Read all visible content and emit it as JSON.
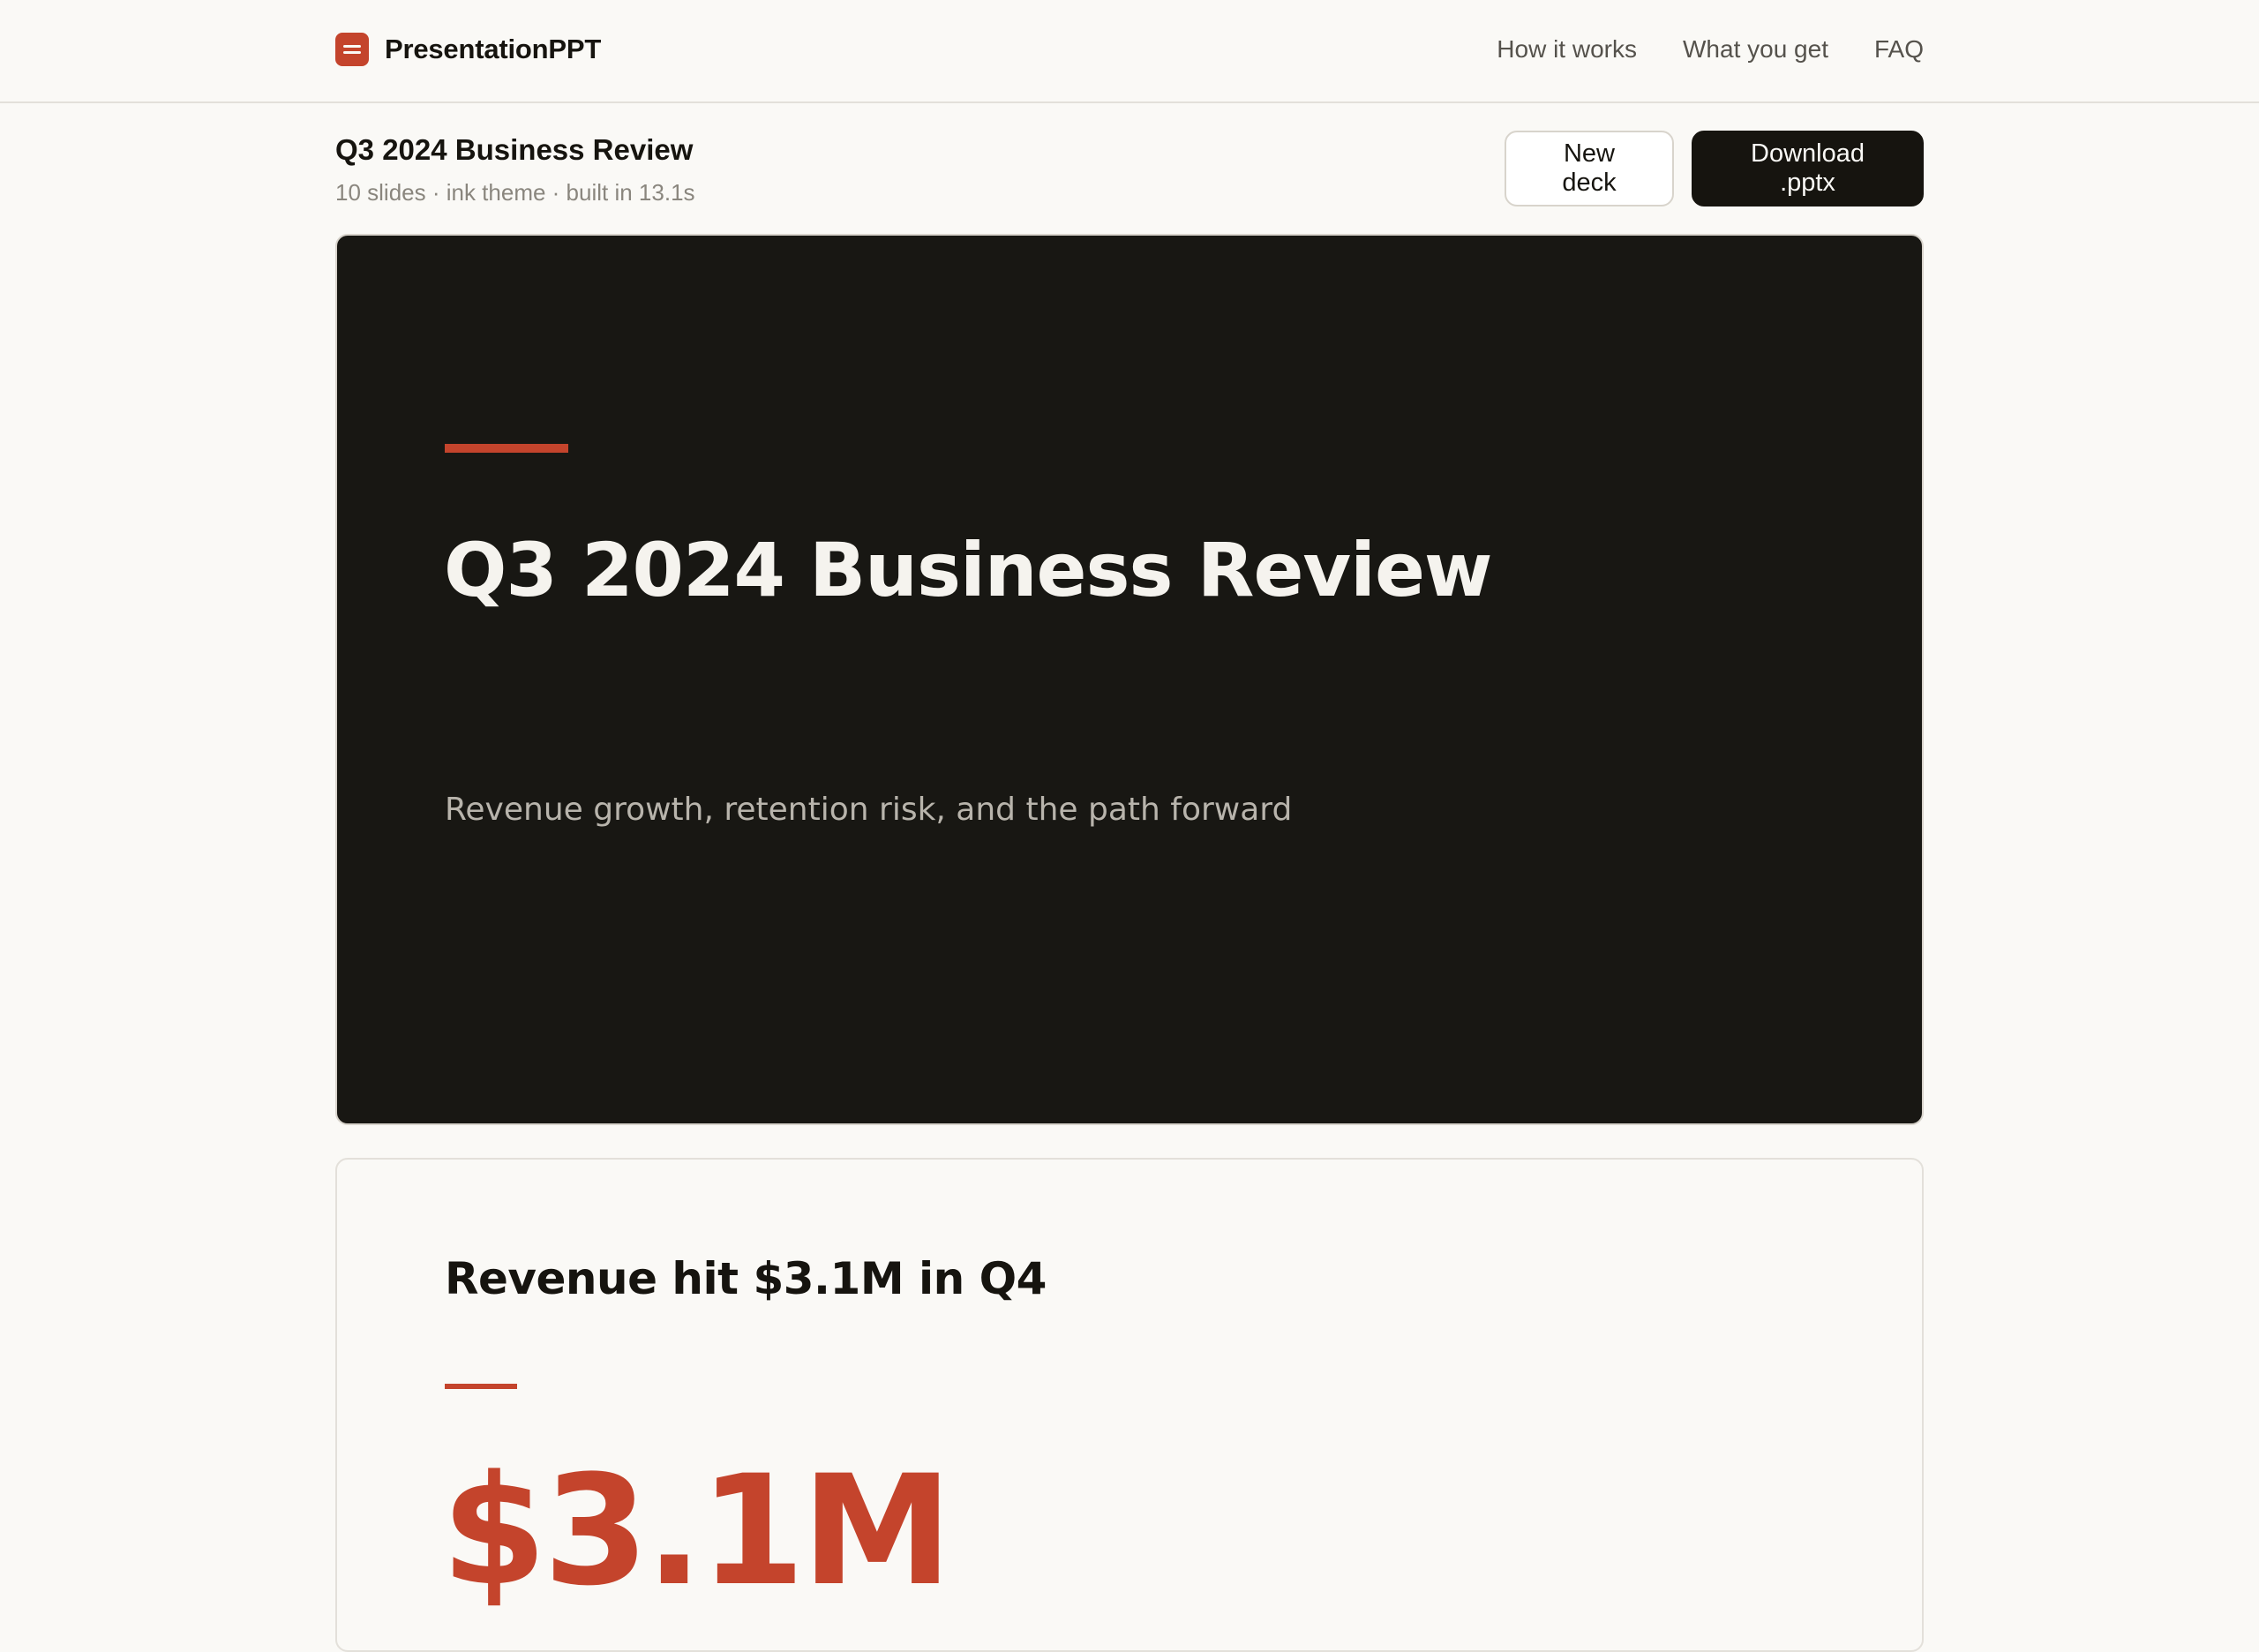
{
  "app": {
    "brand": "PresentationPPT",
    "nav": [
      "How it works",
      "What you get",
      "FAQ"
    ]
  },
  "deck": {
    "title": "Q3 2024 Business Review",
    "meta": "10 slides · ink theme · built in 13.1s",
    "new_deck_label": "New deck",
    "download_label": "Download .pptx"
  },
  "slides": [
    {
      "title": "Q3 2024 Business Review",
      "subtitle": "Revenue growth, retention risk, and the path forward"
    },
    {
      "title": "Revenue hit $3.1M in Q4",
      "big_number": "$3.1M"
    }
  ],
  "colors": {
    "accent": "#c4442c",
    "dark": "#16140f",
    "background": "#faf9f6",
    "slide_dark": "#181713"
  }
}
